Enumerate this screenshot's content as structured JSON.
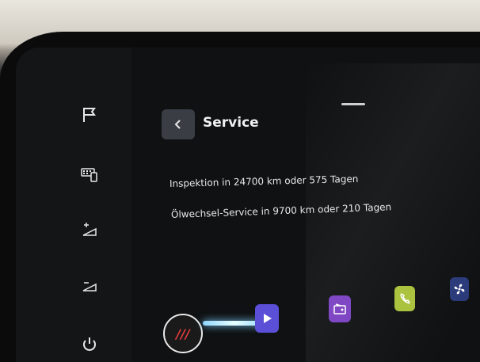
{
  "header": {
    "title": "Service",
    "back_icon": "chevron-left-icon"
  },
  "service_info": {
    "inspection": "Inspektion in 24700 km oder 575 Tagen",
    "oil_service": "Ölwechsel-Service in 9700 km oder 210 Tagen"
  },
  "sidebar": {
    "items": [
      {
        "icon": "flag-icon"
      },
      {
        "icon": "keypad-phone-icon"
      },
      {
        "icon": "brightness-up-icon"
      },
      {
        "icon": "brightness-down-icon"
      },
      {
        "icon": "power-icon"
      }
    ]
  },
  "dock": {
    "apps": [
      {
        "icon": "stop-icon",
        "label": "///",
        "color": "#e23b3b"
      },
      {
        "icon": "play-icon",
        "color": "#5a4fd6"
      },
      {
        "icon": "radio-icon",
        "color": "#7a3fc2"
      },
      {
        "icon": "phone-icon",
        "color": "#a8c23a"
      },
      {
        "icon": "fan-icon",
        "color": "#2a3a7a"
      }
    ]
  }
}
